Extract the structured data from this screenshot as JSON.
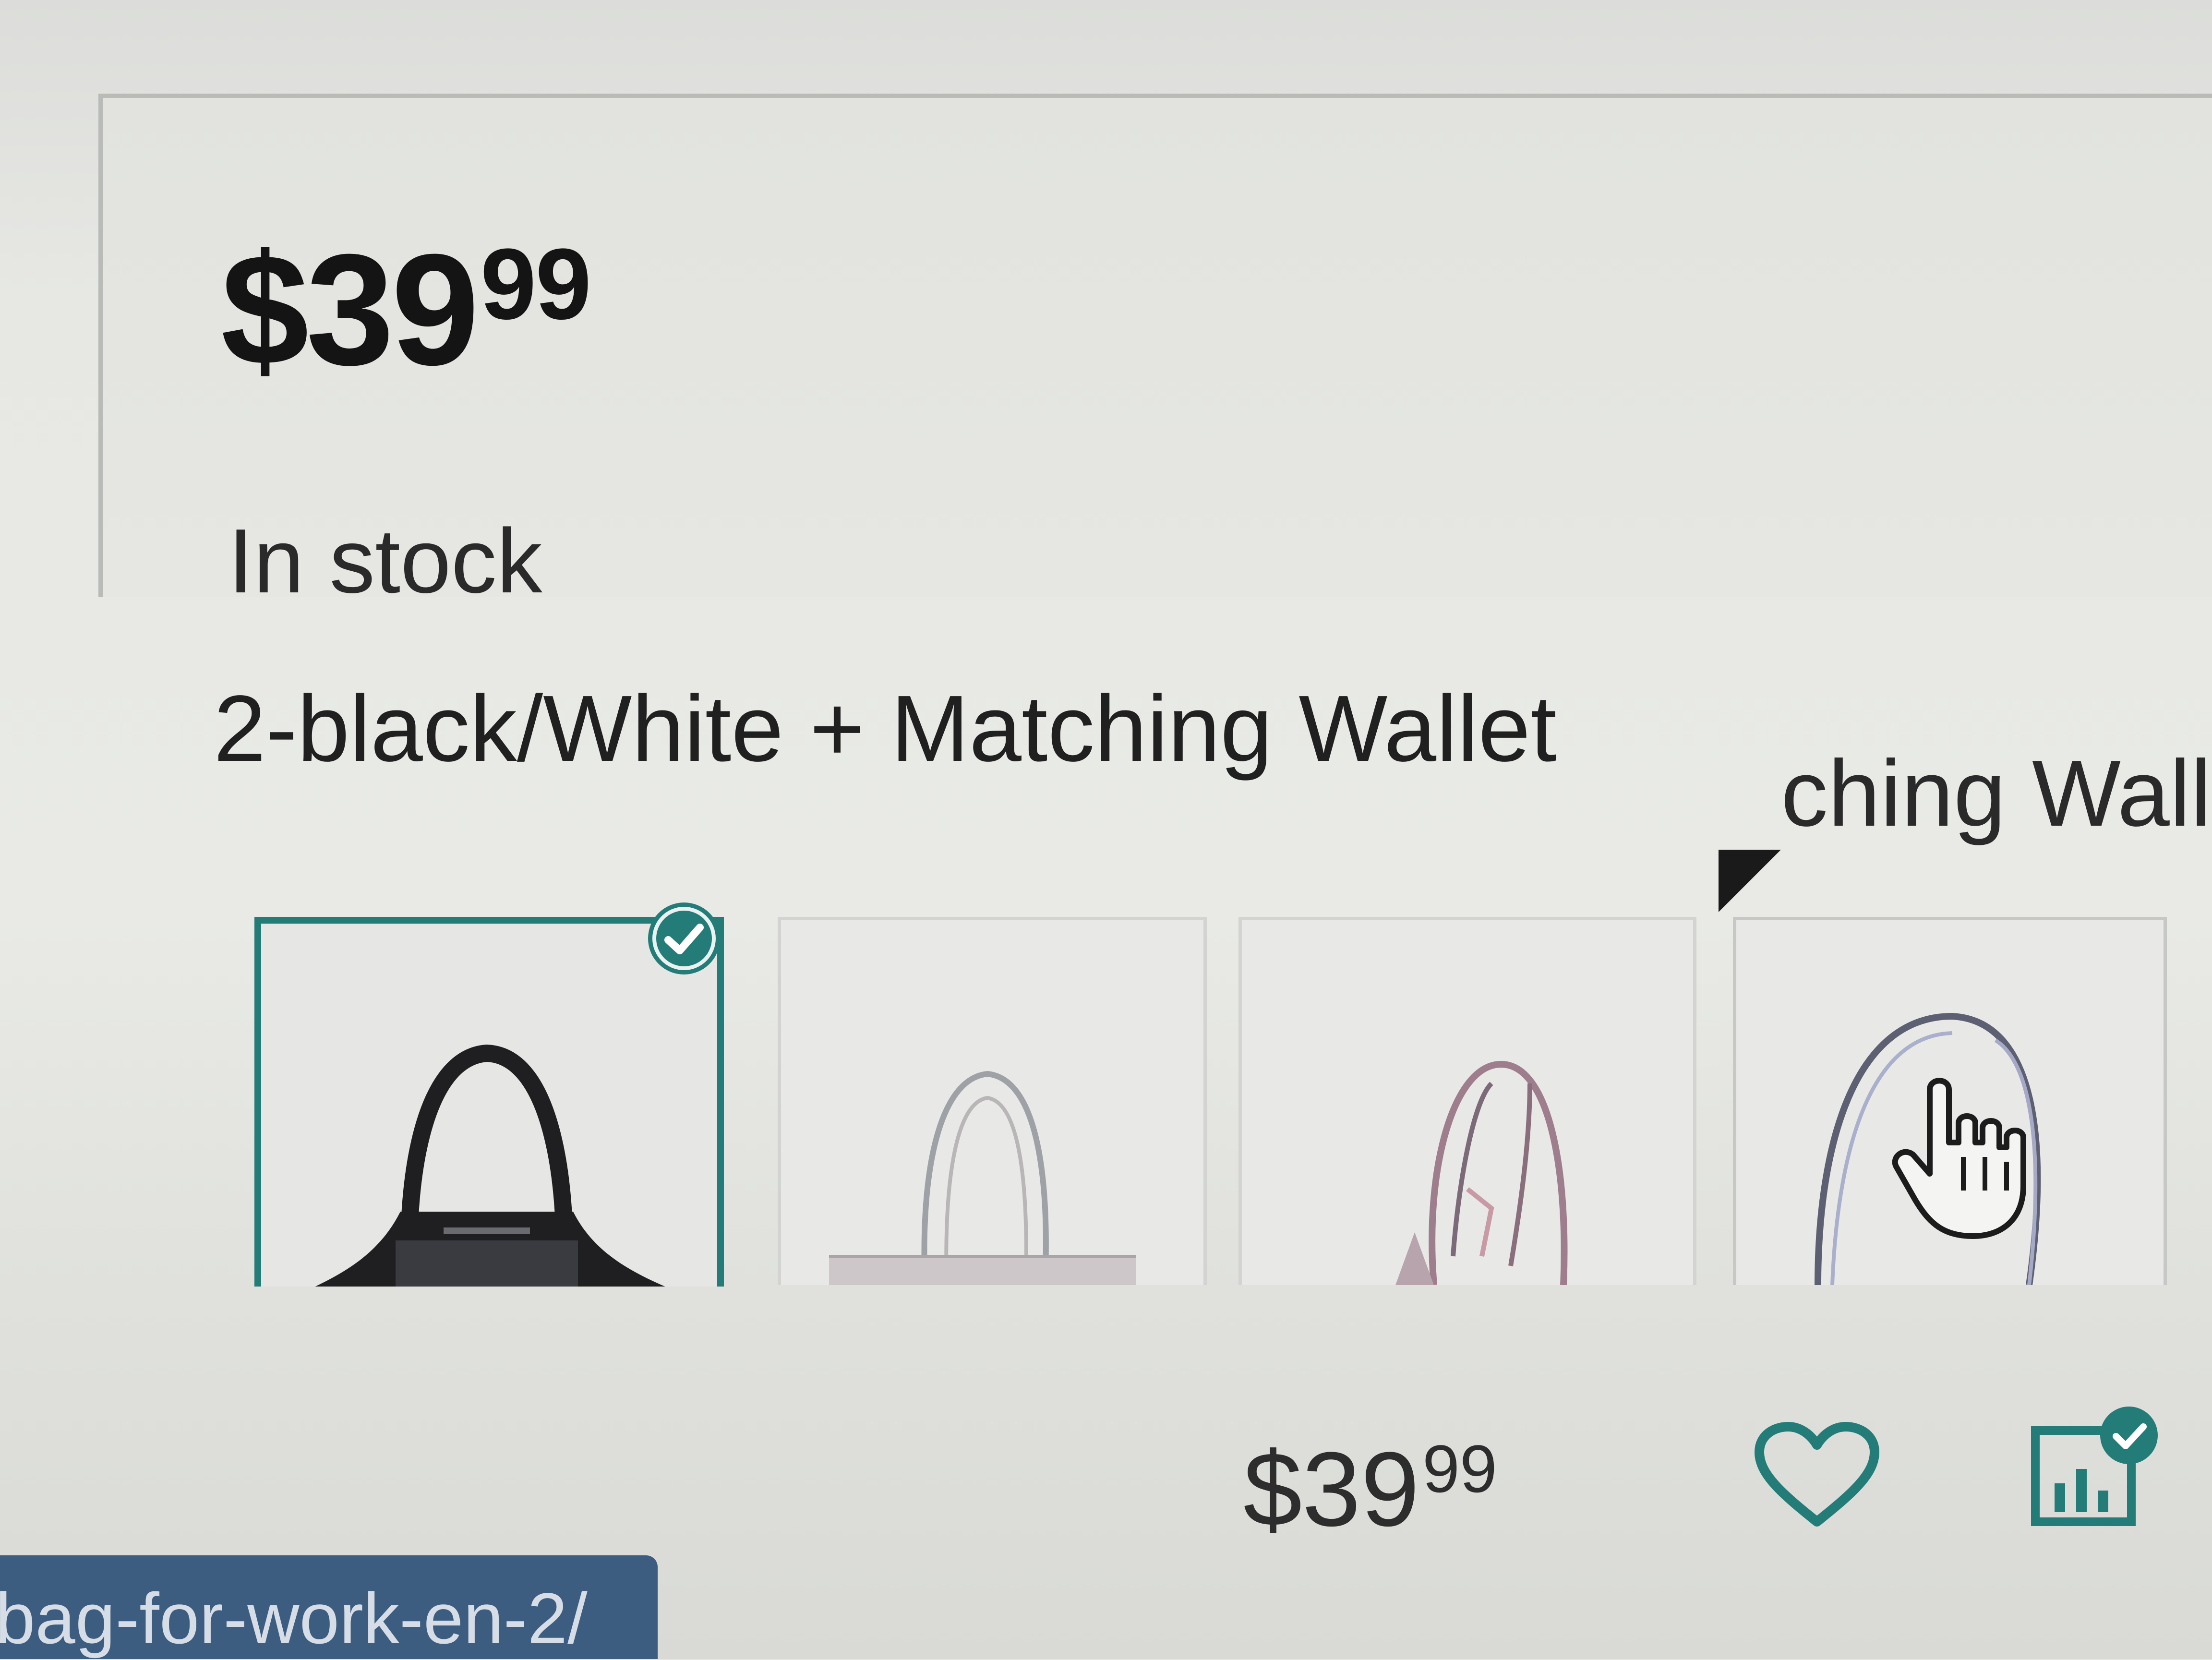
{
  "product": {
    "price_whole": "$39",
    "price_cents": "99",
    "stock_status": "In stock",
    "variant_label": "2-black/White + Matching Wallet",
    "tooltip_partial": "ching Wall"
  },
  "swatches": {
    "selected_index": 0,
    "count": 4,
    "colors": [
      "#1f1f22",
      "#cdc7c9",
      "#c79aa6",
      "#aab0cc"
    ]
  },
  "footer": {
    "price_whole": "$39",
    "price_cents": "99",
    "status_url": "bag-for-work-en-2/"
  },
  "colors": {
    "accent": "#237c78",
    "status_bar": "#3d5d80",
    "heart": "#237c78"
  },
  "icons": [
    "check-icon",
    "hand-cursor-icon",
    "heart-icon",
    "compare-icon"
  ]
}
